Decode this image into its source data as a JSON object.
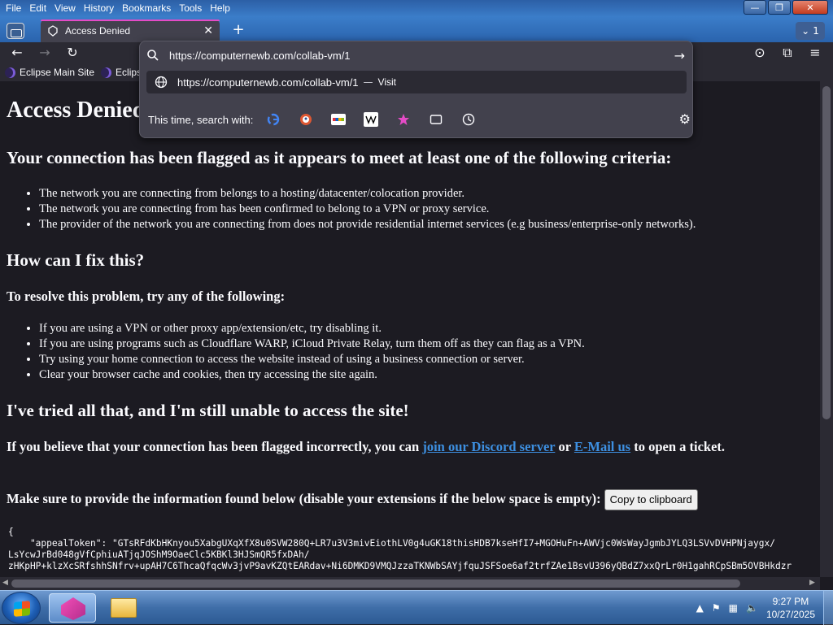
{
  "menu": [
    "File",
    "Edit",
    "View",
    "History",
    "Bookmarks",
    "Tools",
    "Help"
  ],
  "window_controls": {
    "minimize": "—",
    "maximize": "❐",
    "close": "✕"
  },
  "tab": {
    "title": "Access Denied",
    "close": "✕",
    "new_tab": "+",
    "list_count": "1",
    "list_chevron": "⌄"
  },
  "nav": {
    "back": "←",
    "forward": "→",
    "reload": "↻",
    "account": "⊙",
    "extensions": "⧉",
    "menu": "≡"
  },
  "bookmarks": [
    {
      "label": "Eclipse Main Site"
    },
    {
      "label": "Eclips"
    }
  ],
  "urlbar": {
    "value": "https://computernewb.com/collab-vm/1",
    "go": "→",
    "suggestion": {
      "url": "https://computernewb.com/collab-vm/1",
      "sep": "—",
      "action": "Visit"
    },
    "engines_label": "This time, search with:",
    "engines": [
      "google-icon",
      "duckduckgo-icon",
      "ebay-icon",
      "wikipedia-icon",
      "bookmarks-icon",
      "tabs-icon",
      "history-icon"
    ],
    "settings": "⚙"
  },
  "page": {
    "title": "Access Denied",
    "h_criteria": "Your connection has been flagged as it appears to meet at least one of the following criteria:",
    "criteria": [
      "The network you are connecting from belongs to a hosting/datacenter/colocation provider.",
      "The network you are connecting from has been confirmed to belong to a VPN or proxy service.",
      "The provider of the network you are connecting from does not provide residential internet services (e.g business/enterprise-only networks)."
    ],
    "h_fix": "How can I fix this?",
    "h_resolve": "To resolve this problem, try any of the following:",
    "fixes": [
      "If you are using a VPN or other proxy app/extension/etc, try disabling it.",
      "If you are using programs such as Cloudflare WARP, iCloud Private Relay, turn them off as they can flag as a VPN.",
      "Try using your home connection to access the website instead of using a business connection or server.",
      "Clear your browser cache and cookies, then try accessing the site again."
    ],
    "h_tried": "I've tried all that, and I'm still unable to access the site!",
    "p_flagged_pre": "If you believe that your connection has been flagged incorrectly, you can ",
    "link_discord": "join our Discord server",
    "p_or": " or ",
    "link_email": "E-Mail us",
    "p_flagged_post": " to open a ticket.",
    "p_info": "Make sure to provide the information found below (disable your extensions if the below space is empty):",
    "copy_button": "Copy to clipboard",
    "code": "{\n    \"appealToken\": \"GTsRFdKbHKnyou5XabgUXqXfX8u0SVW280Q+LR7u3V3mivEiothLV0g4uGK18thisHDB7kseHfI7+MGOHuFn+AWVjc0WsWayJgmbJYLQ3LSVvDVHPNjaygx/\nLsYcwJrBd048gVfCphiuATjqJOShM9OaeClc5KBKl3HJSmQR5fxDAh/\nzHKpHP+klzXcSRfshhSNfrv+upAH7C6ThcaQfqcWv3jvP9avKZQtEARdav+Ni6DMKD9VMQJzzaTKNWbSAYjfquJSFSoe6af2trfZAe1BsvU396yQBdZ7xxQrLr0H1gahRCpSBm5OVBHkdzr"
  },
  "taskbar": {
    "time": "9:27 PM",
    "date": "10/27/2025",
    "tray_up": "▲",
    "tray_flag": "⚑",
    "tray_net": "▦",
    "tray_vol": "🔈"
  }
}
